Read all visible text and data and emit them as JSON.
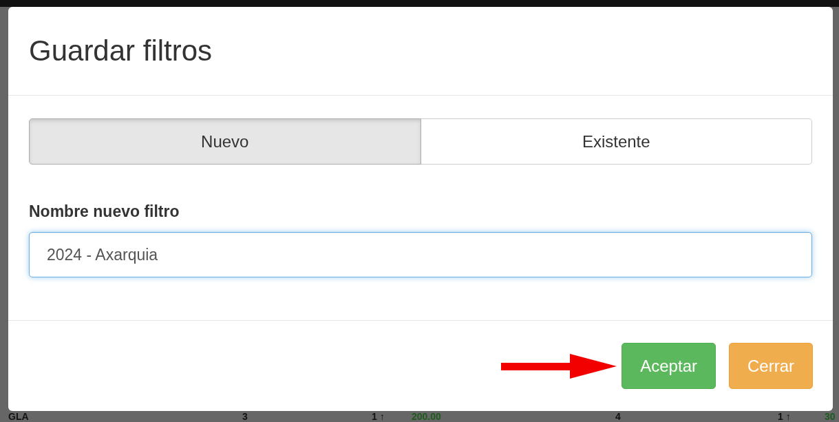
{
  "dialog": {
    "title": "Guardar filtros",
    "tabs": [
      {
        "label": "Nuevo",
        "selected": true
      },
      {
        "label": "Existente",
        "selected": false
      }
    ],
    "field": {
      "label": "Nombre nuevo filtro",
      "value": "2024 - Axarquia"
    },
    "buttons": [
      {
        "label": "Aceptar",
        "kind": "primary"
      },
      {
        "label": "Cerrar",
        "kind": "warning"
      }
    ]
  },
  "background_row": [
    {
      "text": "GLA",
      "color": "#111111"
    },
    {
      "text": "3",
      "color": "#111111"
    },
    {
      "text": "1 ↑",
      "color": "#111111"
    },
    {
      "text": "200.00",
      "color": "#1e5a1e"
    },
    {
      "text": "4",
      "color": "#111111"
    },
    {
      "text": "1 ↑",
      "color": "#111111"
    },
    {
      "text": "30",
      "color": "#1e5a1e"
    }
  ]
}
